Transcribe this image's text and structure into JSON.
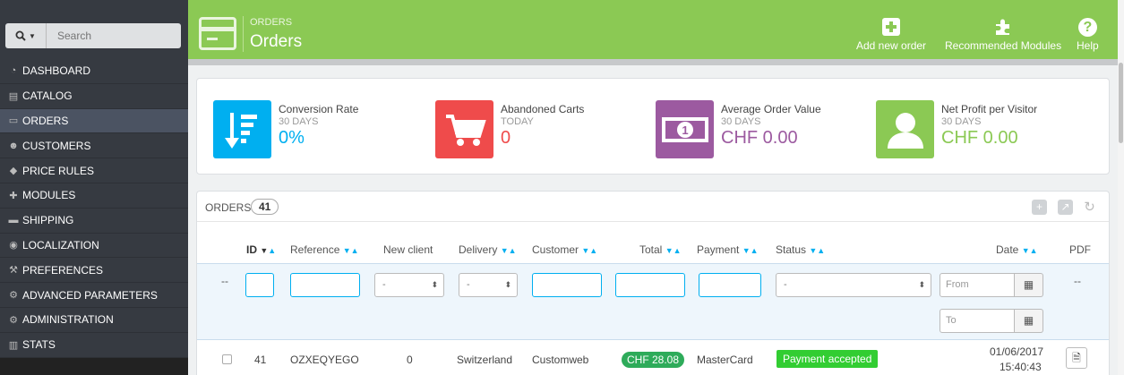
{
  "search": {
    "placeholder": "Search"
  },
  "sidebar": {
    "items": [
      {
        "label": "DASHBOARD",
        "icon": "dashboard-icon",
        "active": false
      },
      {
        "label": "CATALOG",
        "icon": "book-icon",
        "active": false
      },
      {
        "label": "ORDERS",
        "icon": "credit-card-icon",
        "active": true
      },
      {
        "label": "CUSTOMERS",
        "icon": "users-icon",
        "active": false
      },
      {
        "label": "PRICE RULES",
        "icon": "tag-icon",
        "active": false
      },
      {
        "label": "MODULES",
        "icon": "puzzle-icon",
        "active": false
      },
      {
        "label": "SHIPPING",
        "icon": "truck-icon",
        "active": false
      },
      {
        "label": "LOCALIZATION",
        "icon": "globe-icon",
        "active": false
      },
      {
        "label": "PREFERENCES",
        "icon": "wrench-icon",
        "active": false
      },
      {
        "label": "ADVANCED PARAMETERS",
        "icon": "cogs-icon",
        "active": false
      },
      {
        "label": "ADMINISTRATION",
        "icon": "cog-icon",
        "active": false
      },
      {
        "label": "STATS",
        "icon": "bar-chart-icon",
        "active": false
      }
    ]
  },
  "header": {
    "breadcrumb": "ORDERS",
    "title": "Orders",
    "toolbar": {
      "add_label": "Add new order",
      "modules_label": "Recommended Modules",
      "help_label": "Help"
    }
  },
  "kpis": [
    {
      "title": "Conversion Rate",
      "sub": "30 DAYS",
      "value": "0%",
      "color": "#00aff0",
      "icon": "sort-amount-icon"
    },
    {
      "title": "Abandoned Carts",
      "sub": "TODAY",
      "value": "0",
      "color": "#ef4b4b",
      "icon": "cart-icon"
    },
    {
      "title": "Average Order Value",
      "sub": "30 DAYS",
      "value": "CHF 0.00",
      "color": "#9c5aa0",
      "icon": "money-icon"
    },
    {
      "title": "Net Profit per Visitor",
      "sub": "30 DAYS",
      "value": "CHF 0.00",
      "color": "#8bc954",
      "icon": "user-icon"
    }
  ],
  "orders": {
    "title": "ORDERS",
    "count": "41",
    "columns": {
      "id": "ID",
      "reference": "Reference",
      "new_client": "New client",
      "delivery": "Delivery",
      "customer": "Customer",
      "total": "Total",
      "payment": "Payment",
      "status": "Status",
      "date": "Date",
      "pdf": "PDF"
    },
    "filters": {
      "row_marker": "--",
      "new_client_value": "-",
      "delivery_value": "-",
      "status_value": "-",
      "date_from": "From",
      "date_to": "To",
      "pdf_marker": "--"
    },
    "rows": [
      {
        "id": "41",
        "reference": "OZXEQYEGO",
        "new_client": "0",
        "delivery": "Switzerland",
        "customer": "Customweb",
        "total": "CHF 28.08",
        "payment": "MasterCard",
        "status": "Payment accepted",
        "status_color": "#32cd32",
        "date": "01/06/2017",
        "time": "15:40:43"
      }
    ]
  }
}
